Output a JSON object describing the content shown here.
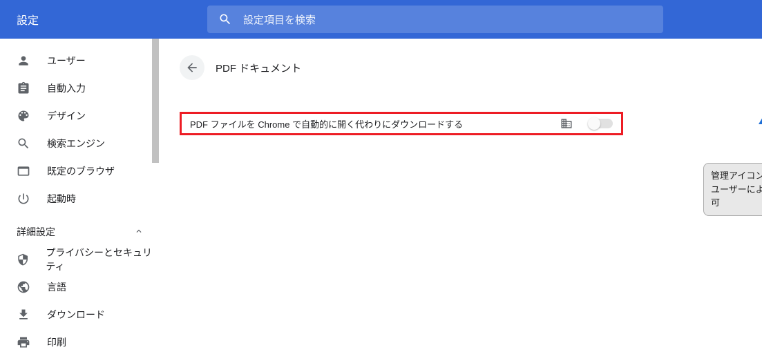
{
  "header": {
    "title": "設定",
    "search_placeholder": "設定項目を検索"
  },
  "sidebar": {
    "items": [
      {
        "label": "ユーザー"
      },
      {
        "label": "自動入力"
      },
      {
        "label": "デザイン"
      },
      {
        "label": "検索エンジン"
      },
      {
        "label": "既定のブラウザ"
      },
      {
        "label": "起動時"
      }
    ],
    "section_label": "詳細設定",
    "advanced": [
      {
        "label": "プライバシーとセキュリティ"
      },
      {
        "label": "言語"
      },
      {
        "label": "ダウンロード"
      },
      {
        "label": "印刷"
      }
    ]
  },
  "page": {
    "title": "PDF ドキュメント",
    "setting_label": "PDF ファイルを Chrome で自動的に開く代わりにダウンロードする"
  },
  "annotation": {
    "line1": "管理アイコンが追加される",
    "line2": "ユーザーによる設定変更不可"
  }
}
